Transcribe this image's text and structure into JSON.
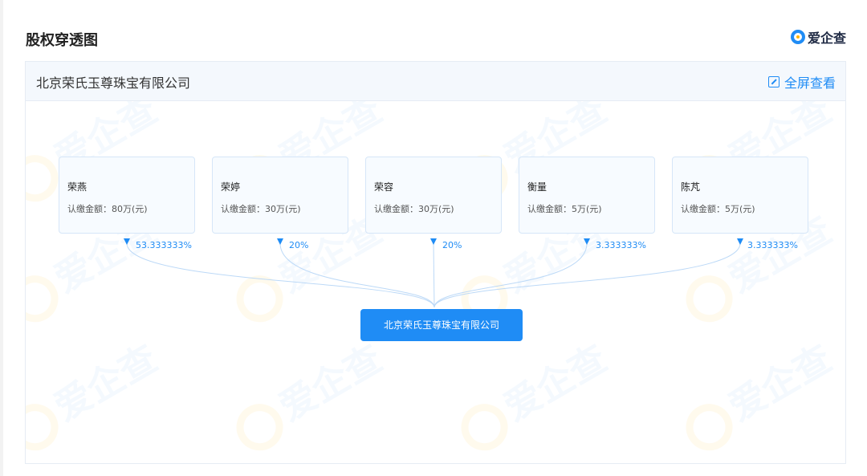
{
  "section_title": "股权穿透图",
  "brand": {
    "name": "爱企查",
    "accent": "#1f8cf5",
    "logo_dot": "#ffb400"
  },
  "panel": {
    "company_name": "北京荣氏玉尊珠宝有限公司",
    "fullscreen_label": "全屏查看",
    "fullscreen_icon": "expand-icon"
  },
  "holders": [
    {
      "name": "荣燕",
      "amount": "认缴金额：80万(元)",
      "percent": "53.333333%"
    },
    {
      "name": "荣婷",
      "amount": "认缴金额：30万(元)",
      "percent": "20%"
    },
    {
      "name": "荣容",
      "amount": "认缴金额：30万(元)",
      "percent": "20%"
    },
    {
      "name": "衡量",
      "amount": "认缴金额：5万(元)",
      "percent": "3.333333%"
    },
    {
      "name": "陈芃",
      "amount": "认缴金额：5万(元)",
      "percent": "3.333333%"
    }
  ],
  "target": {
    "name": "北京荣氏玉尊珠宝有限公司"
  },
  "watermark_text": "爱企查"
}
